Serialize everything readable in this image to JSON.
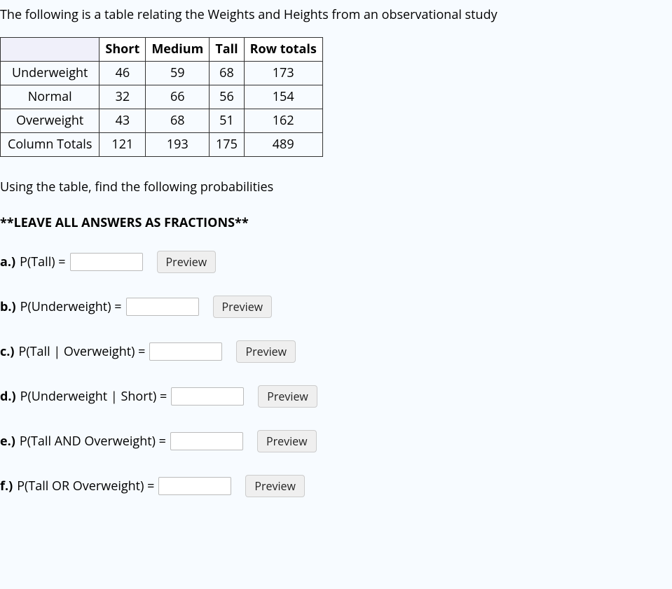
{
  "intro": "The following is a table relating the Weights and Heights from an observational study",
  "table": {
    "headers": [
      "",
      "Short",
      "Medium",
      "Tall",
      "Row totals"
    ],
    "rows": [
      {
        "label": "Underweight",
        "cells": [
          "46",
          "59",
          "68",
          "173"
        ]
      },
      {
        "label": "Normal",
        "cells": [
          "32",
          "66",
          "56",
          "154"
        ]
      },
      {
        "label": "Overweight",
        "cells": [
          "43",
          "68",
          "51",
          "162"
        ]
      },
      {
        "label": "Column Totals",
        "cells": [
          "121",
          "193",
          "175",
          "489"
        ]
      }
    ]
  },
  "subhead": "Using the table, find the following probabilities",
  "instruction": "**LEAVE ALL ANSWERS AS FRACTIONS**",
  "preview_label": "Preview",
  "questions": [
    {
      "label": "a.)",
      "text": "P(Tall) = "
    },
    {
      "label": "b.)",
      "text": "P(Underweight) = "
    },
    {
      "label": "c.)",
      "text": "P(Tall | Overweight) = "
    },
    {
      "label": "d.)",
      "text": "P(Underweight | Short) = "
    },
    {
      "label": "e.)",
      "text": "P(Tall AND Overweight) = "
    },
    {
      "label": "f.)",
      "text": "P(Tall OR Overweight) = "
    }
  ]
}
